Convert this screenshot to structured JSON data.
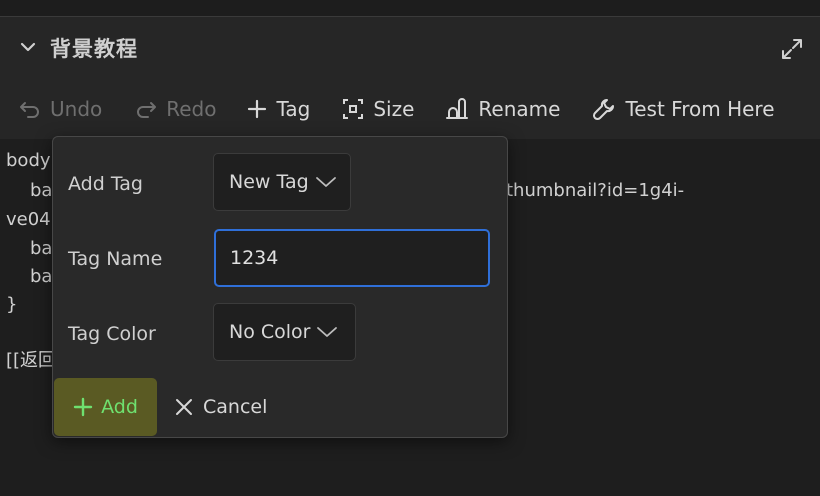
{
  "panel": {
    "title": "背景教程"
  },
  "toolbar": {
    "undo": "Undo",
    "redo": "Redo",
    "tag": "Tag",
    "size": "Size",
    "rename": "Rename",
    "test_from_here": "Test From Here"
  },
  "editor": {
    "lines": [
      "body",
      "ba",
      "thumbnail?id=1g4i-",
      "ve04",
      "ba",
      "ba",
      "}",
      "[[返回"
    ]
  },
  "popup": {
    "add_tag_label": "Add Tag",
    "add_tag_select": "New Tag",
    "tag_name_label": "Tag Name",
    "tag_name_value": "1234",
    "tag_color_label": "Tag Color",
    "tag_color_select": "No Color",
    "add_button": "Add",
    "cancel_button": "Cancel"
  },
  "colors": {
    "accent_blue": "#2f6fd8",
    "add_button_bg": "#5a5a23",
    "add_button_text": "#6fe06f"
  }
}
